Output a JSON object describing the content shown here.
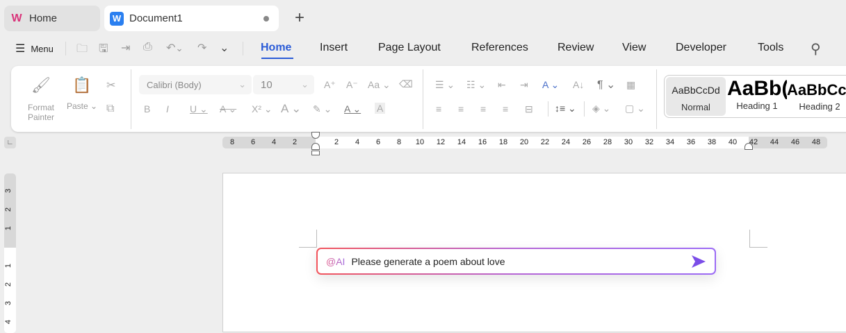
{
  "tabs": [
    {
      "label": "Home",
      "icon": "wps-logo-icon"
    },
    {
      "label": "Document1",
      "icon": "writer-logo-icon",
      "unsaved": true
    }
  ],
  "toolbar": {
    "menu_label": "Menu",
    "quick_icons": [
      "open-folder-icon",
      "save-icon",
      "export-pdf-icon",
      "print-preview-icon",
      "undo-icon",
      "redo-icon",
      "customize-icon"
    ]
  },
  "menu_tabs": [
    "Home",
    "Insert",
    "Page Layout",
    "References",
    "Review",
    "View",
    "Developer",
    "Tools"
  ],
  "active_tab": "Home",
  "ribbon": {
    "format_painter": "Format Painter",
    "format_painter_l1": "Format",
    "format_painter_l2": "Painter",
    "paste": "Paste",
    "font_name": "Calibri (Body)",
    "font_size": "10",
    "styles": [
      {
        "preview": "AaBbCcDd",
        "name": "Normal"
      },
      {
        "preview": "AaBb(",
        "name": "Heading 1"
      },
      {
        "preview": "AaBbCc",
        "name": "Heading 2"
      }
    ]
  },
  "ruler": {
    "left": [
      "8",
      "6",
      "4",
      "2"
    ],
    "right": [
      "2",
      "4",
      "6",
      "8",
      "10",
      "12",
      "14",
      "16",
      "18",
      "20",
      "22",
      "24",
      "26",
      "28",
      "30",
      "32",
      "34",
      "36",
      "38",
      "40",
      "42",
      "44",
      "46",
      "48"
    ],
    "vertical_top": [
      "3",
      "2",
      "1"
    ],
    "vertical_bottom": [
      "1",
      "2",
      "3",
      "4"
    ]
  },
  "ai": {
    "prefix": "@AI",
    "prompt": "Please generate a poem about love",
    "accent": "#7b4de8"
  }
}
